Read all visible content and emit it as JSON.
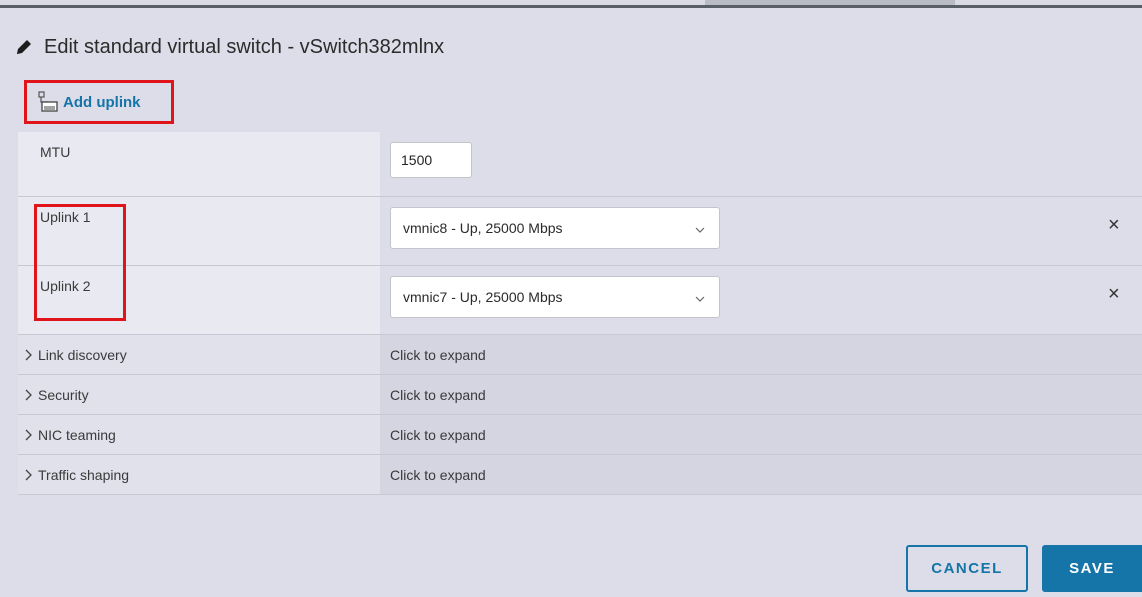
{
  "dialog": {
    "title": "Edit standard virtual switch - vSwitch382mlnx"
  },
  "toolbar": {
    "add_uplink_label": "Add uplink"
  },
  "mtu": {
    "label": "MTU",
    "value": "1500"
  },
  "uplinks": [
    {
      "label": "Uplink 1",
      "selected": "vmnic8 - Up, 25000 Mbps"
    },
    {
      "label": "Uplink 2",
      "selected": "vmnic7 - Up, 25000 Mbps"
    }
  ],
  "sections": [
    {
      "label": "Link discovery",
      "value": "Click to expand"
    },
    {
      "label": "Security",
      "value": "Click to expand"
    },
    {
      "label": "NIC teaming",
      "value": "Click to expand"
    },
    {
      "label": "Traffic shaping",
      "value": "Click to expand"
    }
  ],
  "buttons": {
    "cancel": "CANCEL",
    "save": "SAVE"
  },
  "colors": {
    "accent": "#1574a8",
    "highlight": "#e0151b",
    "background": "#dcdde8"
  },
  "icons": {
    "title": "pencil-icon",
    "add_uplink": "add-uplink-icon",
    "remove": "close-icon",
    "select": "chevron-down-icon",
    "section": "chevron-right-icon"
  }
}
